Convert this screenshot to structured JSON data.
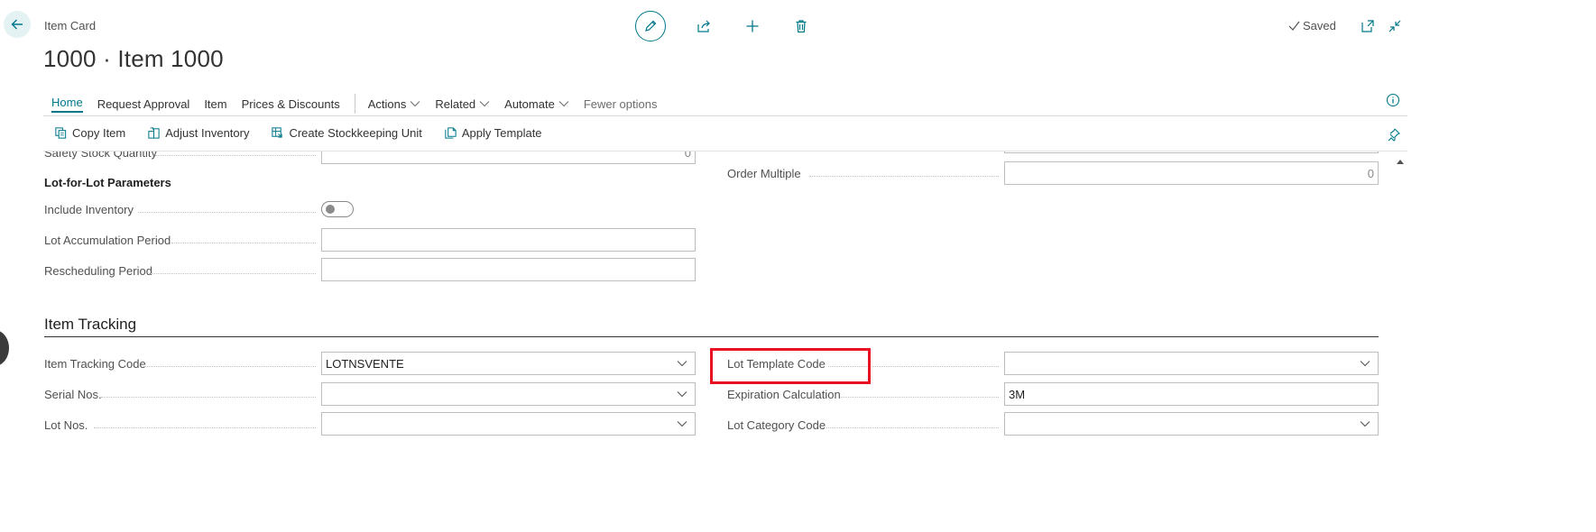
{
  "header": {
    "breadcrumb": "Item Card",
    "title": "1000 · Item 1000",
    "saved_label": "Saved"
  },
  "tabs": [
    {
      "label": "Home",
      "active": true
    },
    {
      "label": "Request Approval"
    },
    {
      "label": "Item"
    },
    {
      "label": "Prices & Discounts"
    }
  ],
  "tabs_dropdown": [
    {
      "label": "Actions"
    },
    {
      "label": "Related"
    },
    {
      "label": "Automate"
    }
  ],
  "tabs_fewer": "Fewer options",
  "actions": [
    {
      "label": "Copy Item",
      "icon": "copy-icon"
    },
    {
      "label": "Adjust Inventory",
      "icon": "adjust-inventory-icon"
    },
    {
      "label": "Create Stockkeeping Unit",
      "icon": "stockkeeping-icon"
    },
    {
      "label": "Apply Template",
      "icon": "template-icon"
    }
  ],
  "planning": {
    "safety_stock_label": "Safety Stock Quantity",
    "safety_stock_value": "0",
    "order_multiple_label": "Order Multiple",
    "order_multiple_value": "0",
    "lot_for_lot_heading": "Lot-for-Lot Parameters",
    "include_inventory_label": "Include Inventory",
    "include_inventory_value": false,
    "lot_accum_label": "Lot Accumulation Period",
    "lot_accum_value": "",
    "rescheduling_label": "Rescheduling Period",
    "rescheduling_value": ""
  },
  "item_tracking": {
    "section_title": "Item Tracking",
    "tracking_code_label": "Item Tracking Code",
    "tracking_code_value": "LOTNSVENTE",
    "serial_nos_label": "Serial Nos.",
    "serial_nos_value": "",
    "lot_nos_label": "Lot Nos.",
    "lot_nos_value": "",
    "lot_template_label": "Lot Template Code",
    "lot_template_value": "",
    "expiration_label": "Expiration Calculation",
    "expiration_value": "3M",
    "lot_category_label": "Lot Category Code",
    "lot_category_value": ""
  },
  "colors": {
    "accent": "#00788a",
    "highlight": "#e81123"
  }
}
